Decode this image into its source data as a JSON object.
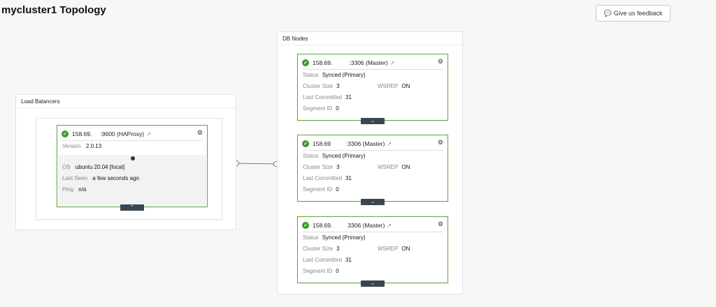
{
  "page": {
    "title": "mycluster1 Topology"
  },
  "feedback": {
    "icon": "chat-bubble-icon",
    "label": "Give us feedback"
  },
  "load_balancers": {
    "title": "Load Balancers",
    "node": {
      "ip": "158.69.",
      "port_label": ":9600 (HAProxy)",
      "version_label": "Version",
      "version": "2.0.13",
      "os_label": "OS",
      "os": "ubuntu 20.04 [focal]",
      "last_seen_label": "Last Seen",
      "last_seen": "a few seconds ago",
      "ping_label": "Ping",
      "ping": "n/a",
      "toggle": "^"
    }
  },
  "db_nodes": {
    "title": "DB Nodes",
    "nodes": [
      {
        "ip": "158.69.",
        "port_label": ":3306 (Master)",
        "status_label": "Status",
        "status": "Synced (Primary)",
        "cluster_size_label": "Cluster Size",
        "cluster_size": "3",
        "wsrep_label": "WSREP",
        "wsrep": "ON",
        "last_committed_label": "Last Committed",
        "last_committed": "31",
        "segment_label": "Segment ID",
        "segment": "0",
        "toggle": "v"
      },
      {
        "ip": "158.69",
        "port_label": ":3306 (Master)",
        "status_label": "Status",
        "status": "Synced (Primary)",
        "cluster_size_label": "Cluster Size",
        "cluster_size": "3",
        "wsrep_label": "WSREP",
        "wsrep": "ON",
        "last_committed_label": "Last Committed",
        "last_committed": "31",
        "segment_label": "Segment ID",
        "segment": "0",
        "toggle": "v"
      },
      {
        "ip": "158.69.",
        "port_label": "3306 (Master)",
        "status_label": "Status",
        "status": "Synced (Primary)",
        "cluster_size_label": "Cluster Size",
        "cluster_size": "3",
        "wsrep_label": "WSREP",
        "wsrep": "ON",
        "last_committed_label": "Last Committed",
        "last_committed": "31",
        "segment_label": "Segment ID",
        "segment": "0",
        "toggle": "v"
      }
    ]
  },
  "colors": {
    "ok": "#3c9a2d",
    "card_border": "#5ea83a",
    "toggle_bg": "#3a4650"
  }
}
